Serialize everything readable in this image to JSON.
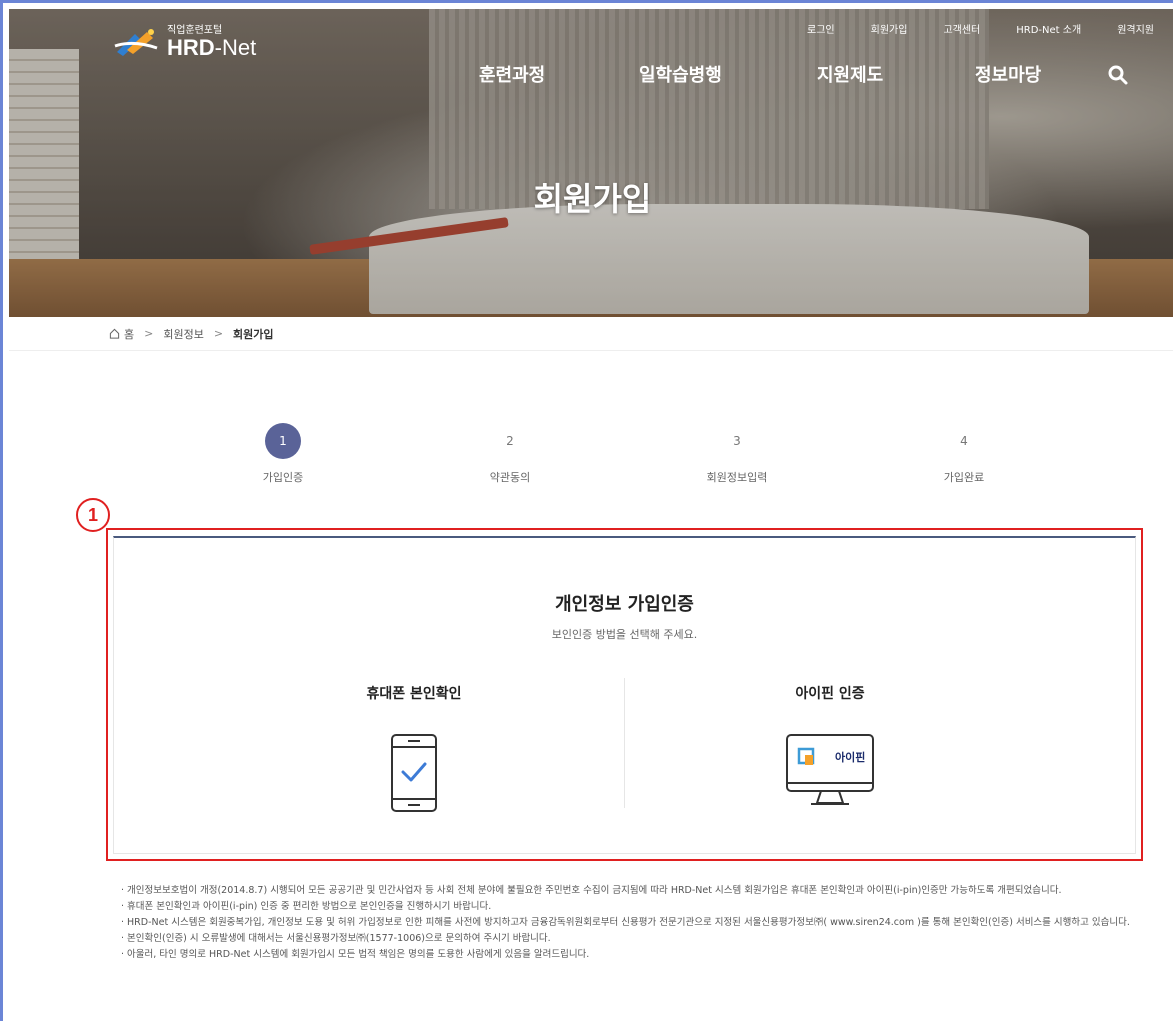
{
  "header": {
    "logo_sub": "직업훈련포털",
    "logo_main": "HRD",
    "logo_main_suffix": "-Net",
    "util_nav": [
      "로그인",
      "회원가입",
      "고객센터",
      "HRD-Net 소개",
      "원격지원"
    ],
    "main_nav": [
      "훈련과정",
      "일학습병행",
      "지원제도",
      "정보마당"
    ],
    "search_icon": "search-icon"
  },
  "hero": {
    "title": "회원가입"
  },
  "breadcrumb": {
    "home": "홈",
    "level1": "회원정보",
    "current": "회원가입",
    "sep": ">"
  },
  "steps": [
    {
      "num": "1",
      "label": "가입인증",
      "active": true
    },
    {
      "num": "2",
      "label": "약관동의",
      "active": false
    },
    {
      "num": "3",
      "label": "회원정보입력",
      "active": false
    },
    {
      "num": "4",
      "label": "가입완료",
      "active": false
    }
  ],
  "annotation": {
    "number": "1",
    "color": "#e02020"
  },
  "auth": {
    "title": "개인정보 가입인증",
    "subtitle": "보인인증 방법을 선택해 주세요.",
    "phone_label": "휴대폰 본인확인",
    "ipin_label": "아이핀 인증",
    "ipin_logo_text": "아이핀"
  },
  "notes": [
    "· 개인정보보호법이 개정(2014.8.7) 시행되어 모든 공공기관 및 민간사업자 등 사회 전체 분야에 불필요한 주민번호 수집이 금지됨에 따라 HRD-Net 시스템 회원가입은 휴대폰 본인확인과 아이핀(i-pin)인증만 가능하도록 개편되었습니다.",
    "· 휴대폰 본인확인과 아이핀(i-pin) 인증 중 편리한 방법으로 본인인증을 진행하시기 바랍니다.",
    "· HRD-Net 시스템은 회원중복가입, 개인정보 도용 및 허위 가입정보로 인한 피해를 사전에 방지하고자 금융감독위원회로부터 신용평가 전문기관으로 지정된 서울신용평가정보㈜( www.siren24.com )를 통해 본인확인(인증) 서비스를 시행하고 있습니다.",
    "· 본인확인(인증) 시 오류발생에 대해서는 서울신용평가정보㈜(1577-1006)으로 문의하여 주시기 바랍니다.",
    "· 아울러, 타인 명의로 HRD-Net 시스템에 회원가입시 모든 법적 책임은 명의를 도용한 사람에게 있음을 알려드립니다."
  ],
  "colors": {
    "accent": "#5a6398",
    "annotation": "#e02020",
    "card_top": "#4a5a7e",
    "check": "#3d7bd6"
  }
}
